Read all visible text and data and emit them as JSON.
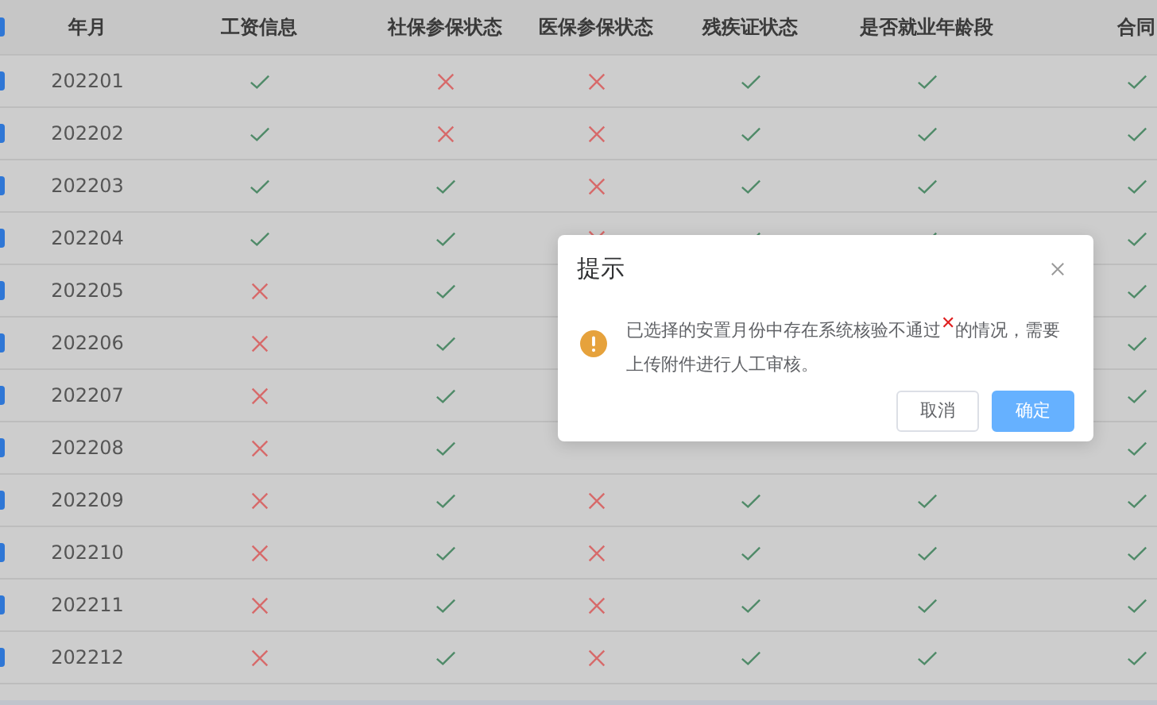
{
  "table": {
    "all_checked": true,
    "columns": [
      "年月",
      "工资信息",
      "社保参保状态",
      "医保参保状态",
      "残疾证状态",
      "是否就业年龄段",
      "合同"
    ],
    "rows": [
      {
        "checked": true,
        "month": "202201",
        "cells": [
          {
            "passed": true
          },
          {
            "passed": false
          },
          {
            "passed": false
          },
          {
            "passed": true
          },
          {
            "passed": true
          },
          {
            "passed": true
          }
        ]
      },
      {
        "checked": true,
        "month": "202202",
        "cells": [
          {
            "passed": true
          },
          {
            "passed": false
          },
          {
            "passed": false
          },
          {
            "passed": true
          },
          {
            "passed": true
          },
          {
            "passed": true
          }
        ]
      },
      {
        "checked": true,
        "month": "202203",
        "cells": [
          {
            "passed": true
          },
          {
            "passed": true
          },
          {
            "passed": false
          },
          {
            "passed": true
          },
          {
            "passed": true
          },
          {
            "passed": true
          }
        ]
      },
      {
        "checked": true,
        "month": "202204",
        "cells": [
          {
            "passed": true
          },
          {
            "passed": true
          },
          {
            "passed": false
          },
          {
            "passed": true
          },
          {
            "passed": true
          },
          {
            "passed": true
          }
        ]
      },
      {
        "checked": true,
        "month": "202205",
        "cells": [
          {
            "passed": false
          },
          {
            "passed": true
          },
          null,
          null,
          null,
          {
            "passed": true
          }
        ]
      },
      {
        "checked": true,
        "month": "202206",
        "cells": [
          {
            "passed": false
          },
          {
            "passed": true
          },
          null,
          null,
          null,
          {
            "passed": true
          }
        ]
      },
      {
        "checked": true,
        "month": "202207",
        "cells": [
          {
            "passed": false
          },
          {
            "passed": true
          },
          null,
          null,
          null,
          {
            "passed": true
          }
        ]
      },
      {
        "checked": true,
        "month": "202208",
        "cells": [
          {
            "passed": false
          },
          {
            "passed": true
          },
          null,
          null,
          null,
          {
            "passed": true
          }
        ]
      },
      {
        "checked": true,
        "month": "202209",
        "cells": [
          {
            "passed": false
          },
          {
            "passed": true
          },
          {
            "passed": false
          },
          {
            "passed": true
          },
          {
            "passed": true
          },
          {
            "passed": true
          }
        ]
      },
      {
        "checked": true,
        "month": "202210",
        "cells": [
          {
            "passed": false
          },
          {
            "passed": true
          },
          {
            "passed": false
          },
          {
            "passed": true
          },
          {
            "passed": true
          },
          {
            "passed": true
          }
        ]
      },
      {
        "checked": true,
        "month": "202211",
        "cells": [
          {
            "passed": false
          },
          {
            "passed": true
          },
          {
            "passed": false
          },
          {
            "passed": true
          },
          {
            "passed": true
          },
          {
            "passed": true
          }
        ]
      },
      {
        "checked": true,
        "month": "202212",
        "cells": [
          {
            "passed": false
          },
          {
            "passed": true
          },
          {
            "passed": false
          },
          {
            "passed": true
          },
          {
            "passed": true
          },
          {
            "passed": true
          }
        ]
      }
    ]
  },
  "dialog": {
    "title": "提示",
    "message": "已选择的安置月份中存在系统核验不通过$^{✕}$的情况，需要上传附件进行人工审核。",
    "buttons": [
      {
        "label": "取消",
        "kind": "secondary"
      },
      {
        "label": "确定",
        "kind": "primary"
      }
    ]
  }
}
